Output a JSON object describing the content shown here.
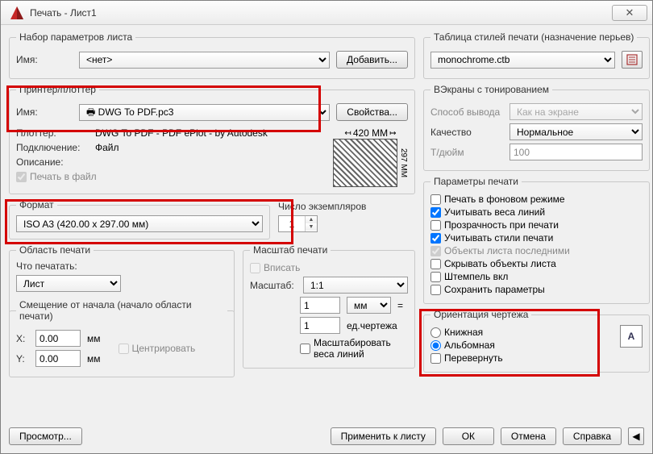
{
  "window": {
    "title": "Печать - Лист1"
  },
  "pageSetup": {
    "legend": "Набор параметров листа",
    "nameLabel": "Имя:",
    "nameValue": "<нет>",
    "addBtn": "Добавить..."
  },
  "printer": {
    "legend": "Принтер/плоттер",
    "nameLabel": "Имя:",
    "nameValue": "DWG To PDF.pc3",
    "propsBtn": "Свойства...",
    "plotterLabel": "Плоттер:",
    "plotterValue": "DWG To PDF - PDF ePlot - by Autodesk",
    "connLabel": "Подключение:",
    "connValue": "Файл",
    "descLabel": "Описание:",
    "toFileLabel": "Печать в файл",
    "dim1": "420 MM",
    "dim2": "297 MM"
  },
  "format": {
    "legend": "Формат",
    "value": "ISO A3 (420.00 x 297.00 мм)"
  },
  "copies": {
    "label": "Число экземпляров",
    "value": "1"
  },
  "area": {
    "legend": "Область печати",
    "whatLabel": "Что печатать:",
    "whatValue": "Лист"
  },
  "scale": {
    "legend": "Масштаб печати",
    "fitLabel": "Вписать",
    "scaleLabel": "Масштаб:",
    "scaleValue": "1:1",
    "numValue": "1",
    "unitValue": "мм",
    "eq": "=",
    "denValue": "1",
    "denUnit": "ед.чертежа",
    "lwLabel": "Масштабировать веса линий"
  },
  "offset": {
    "legend": "Смещение от начала (начало области печати)",
    "xLabel": "X:",
    "xValue": "0.00",
    "xUnit": "мм",
    "yLabel": "Y:",
    "yValue": "0.00",
    "yUnit": "мм",
    "centerLabel": "Центрировать"
  },
  "styles": {
    "legend": "Таблица стилей печати (назначение перьев)",
    "value": "monochrome.ctb"
  },
  "shaded": {
    "legend": "ВЭкраны с тонированием",
    "modeLabel": "Способ вывода",
    "modeValue": "Как на экране",
    "qualityLabel": "Качество",
    "qualityValue": "Нормальное",
    "dpiLabel": "Т/дюйм",
    "dpiValue": "100"
  },
  "options": {
    "legend": "Параметры печати",
    "items": [
      {
        "label": "Печать в фоновом режиме",
        "checked": false,
        "disabled": false
      },
      {
        "label": "Учитывать веса линий",
        "checked": true,
        "disabled": false
      },
      {
        "label": "Прозрачность при печати",
        "checked": false,
        "disabled": false
      },
      {
        "label": "Учитывать стили печати",
        "checked": true,
        "disabled": false
      },
      {
        "label": "Объекты листа последними",
        "checked": true,
        "disabled": true
      },
      {
        "label": "Скрывать объекты листа",
        "checked": false,
        "disabled": false
      },
      {
        "label": "Штемпель вкл",
        "checked": false,
        "disabled": false
      },
      {
        "label": "Сохранить параметры",
        "checked": false,
        "disabled": false
      }
    ]
  },
  "orient": {
    "legend": "Ориентация чертежа",
    "portrait": "Книжная",
    "landscape": "Альбомная",
    "upside": "Перевернуть",
    "iconLetter": "A"
  },
  "footer": {
    "preview": "Просмотр...",
    "apply": "Применить к листу",
    "ok": "ОК",
    "cancel": "Отмена",
    "help": "Справка"
  }
}
